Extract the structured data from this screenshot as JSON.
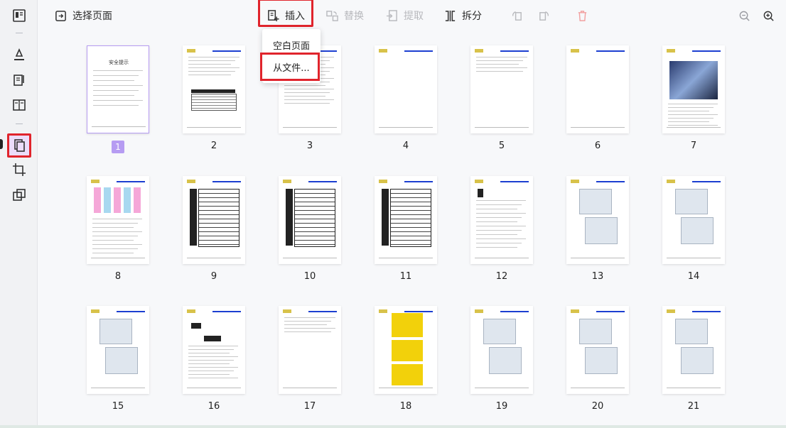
{
  "sidebar": {
    "icons": [
      "panel-icon",
      "highlight-icon",
      "edit-icon",
      "read-icon",
      "organize-pages-icon",
      "crop-icon",
      "compare-icon"
    ]
  },
  "toolbar": {
    "select_pages": "选择页面",
    "insert": "插入",
    "replace": "替换",
    "extract": "提取",
    "split": "拆分"
  },
  "insert_menu": {
    "items": [
      "空白页面",
      "从文件..."
    ]
  },
  "pages": {
    "labels": [
      "1",
      "2",
      "3",
      "4",
      "5",
      "6",
      "7",
      "8",
      "9",
      "10",
      "11",
      "12",
      "13",
      "14",
      "15",
      "16",
      "17",
      "18",
      "19",
      "20",
      "21"
    ],
    "selected": "1",
    "first_page_title": "安全提示"
  },
  "colors": {
    "accent": "#b69cf2",
    "highlight": "#e0242c",
    "header_bar": "#1c3fd1"
  }
}
